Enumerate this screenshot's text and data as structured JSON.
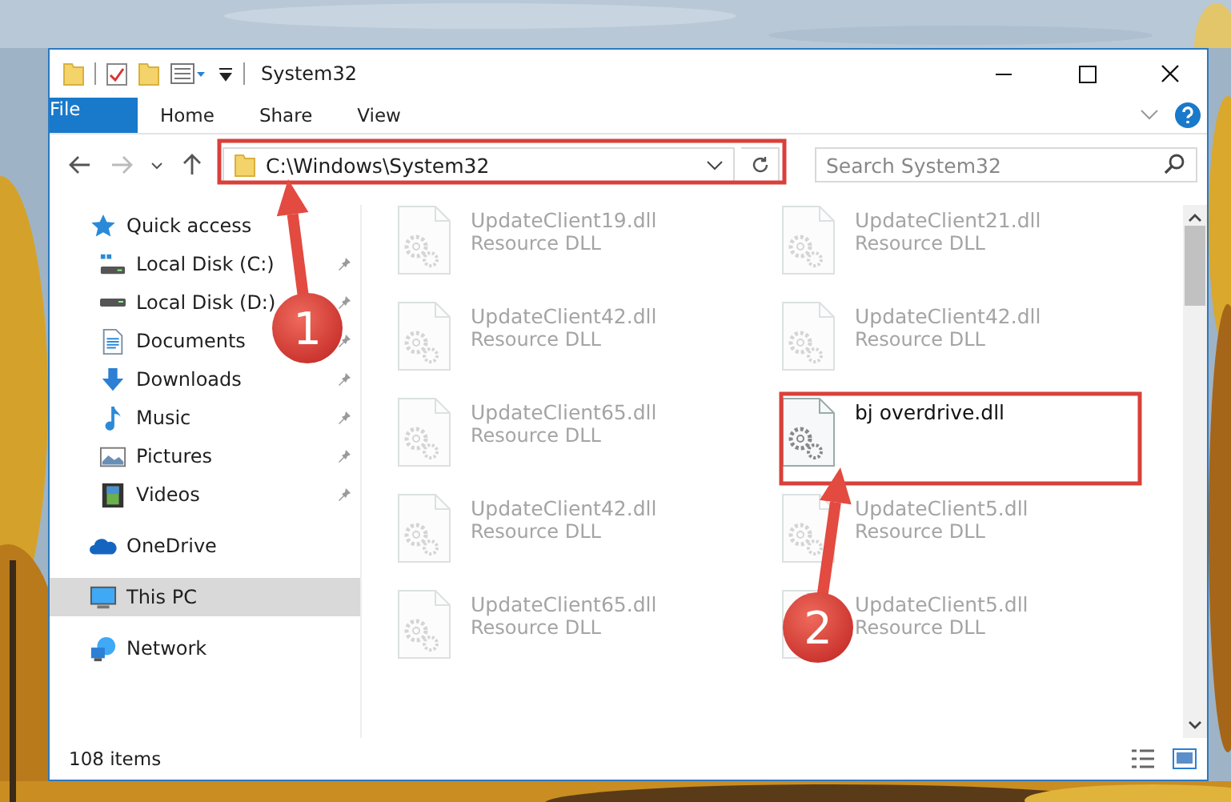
{
  "window": {
    "title": "System32"
  },
  "ribbon": {
    "tabs": [
      {
        "label": "File",
        "kind": "file"
      },
      {
        "label": "Home",
        "kind": "tab"
      },
      {
        "label": "Share",
        "kind": "tab"
      },
      {
        "label": "View",
        "kind": "tab"
      }
    ]
  },
  "address": {
    "path": "C:\\Windows\\System32"
  },
  "search": {
    "placeholder": "Search System32"
  },
  "sidebar": {
    "items": [
      {
        "label": "Quick access",
        "kind": "quick-access",
        "selected": false,
        "children": [
          {
            "label": "Local Disk (C:)",
            "kind": "system-disk",
            "pinned": true
          },
          {
            "label": "Local Disk (D:)",
            "kind": "disk",
            "pinned": true
          },
          {
            "label": "Documents",
            "kind": "documents",
            "pinned": true
          },
          {
            "label": "Downloads",
            "kind": "downloads",
            "pinned": true
          },
          {
            "label": "Music",
            "kind": "music",
            "pinned": true
          },
          {
            "label": "Pictures",
            "kind": "pictures",
            "pinned": true
          },
          {
            "label": "Videos",
            "kind": "videos",
            "pinned": true
          }
        ]
      },
      {
        "label": "OneDrive",
        "kind": "onedrive",
        "selected": false
      },
      {
        "label": "This PC",
        "kind": "this-pc",
        "selected": true
      },
      {
        "label": "Network",
        "kind": "network",
        "selected": false
      }
    ]
  },
  "files": [
    {
      "name": "UpdateClient19.dll",
      "type": "Resource DLL",
      "faded": true
    },
    {
      "name": "UpdateClient21.dll",
      "type": "Resource DLL",
      "faded": true
    },
    {
      "name": "UpdateClient42.dll",
      "type": "Resource DLL",
      "faded": true
    },
    {
      "name": "UpdateClient42.dll",
      "type": "Resource DLL",
      "faded": true
    },
    {
      "name": "UpdateClient65.dll",
      "type": "Resource DLL",
      "faded": true
    },
    {
      "name": "bj overdrive.dll",
      "faded": false
    },
    {
      "name": "UpdateClient42.dll",
      "type": "Resource DLL",
      "faded": true
    },
    {
      "name": "UpdateClient5.dll",
      "type": "Resource DLL",
      "faded": true
    },
    {
      "name": "UpdateClient65.dll",
      "type": "Resource DLL",
      "faded": true
    },
    {
      "name": "UpdateClient5.dll",
      "type": "Resource DLL",
      "faded": true
    }
  ],
  "status_bar": {
    "item_count": "108 items"
  },
  "annotations": {
    "steps": [
      {
        "number": "1"
      },
      {
        "number": "2"
      }
    ]
  }
}
